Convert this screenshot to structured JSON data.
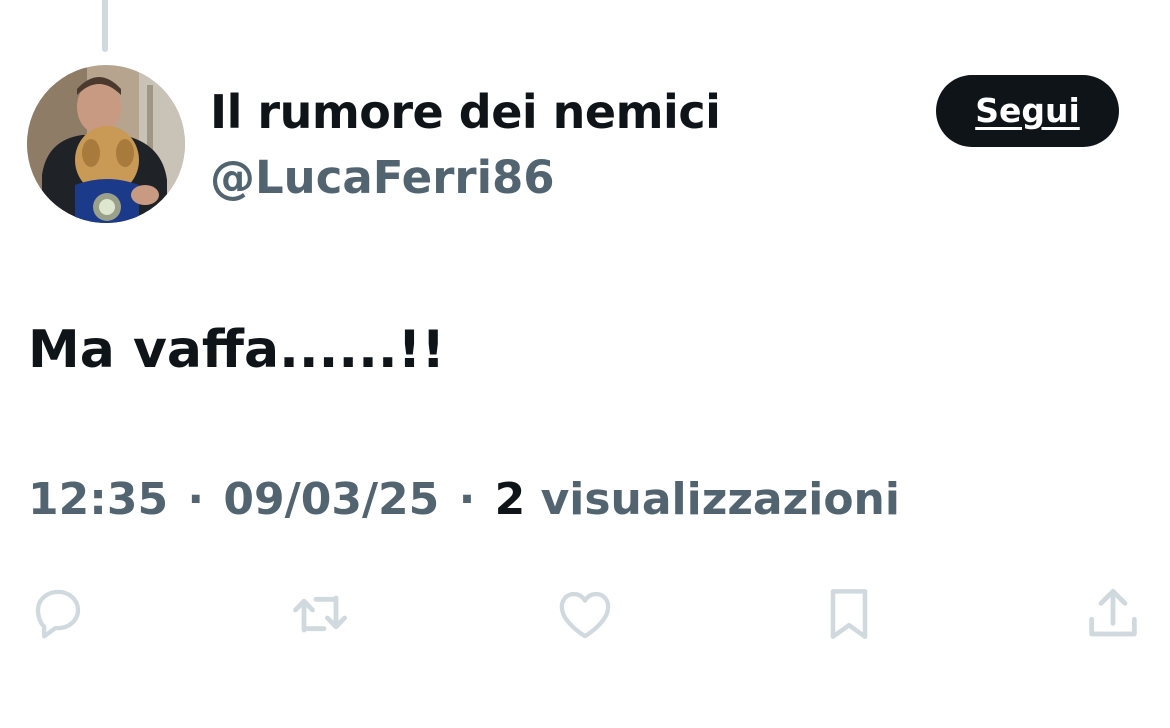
{
  "author": {
    "display_name": "Il rumore dei nemici",
    "handle": "@LucaFerri86",
    "avatar_icon": "profile-photo"
  },
  "follow_button": {
    "label": "Segui"
  },
  "tweet": {
    "text": "Ma vaffa......!!",
    "time": "12:35",
    "date": "09/03/25",
    "separator": "·",
    "views_count": "2",
    "views_label": "visualizzazioni"
  },
  "actions": [
    {
      "icon": "reply-icon"
    },
    {
      "icon": "retweet-icon"
    },
    {
      "icon": "like-icon"
    },
    {
      "icon": "bookmark-icon"
    },
    {
      "icon": "share-icon"
    }
  ],
  "colors": {
    "text_primary": "#0f1419",
    "text_secondary": "#536471",
    "icon_muted": "#cfd9de",
    "button_bg": "#0f1419",
    "button_text": "#ffffff",
    "background": "#ffffff"
  }
}
